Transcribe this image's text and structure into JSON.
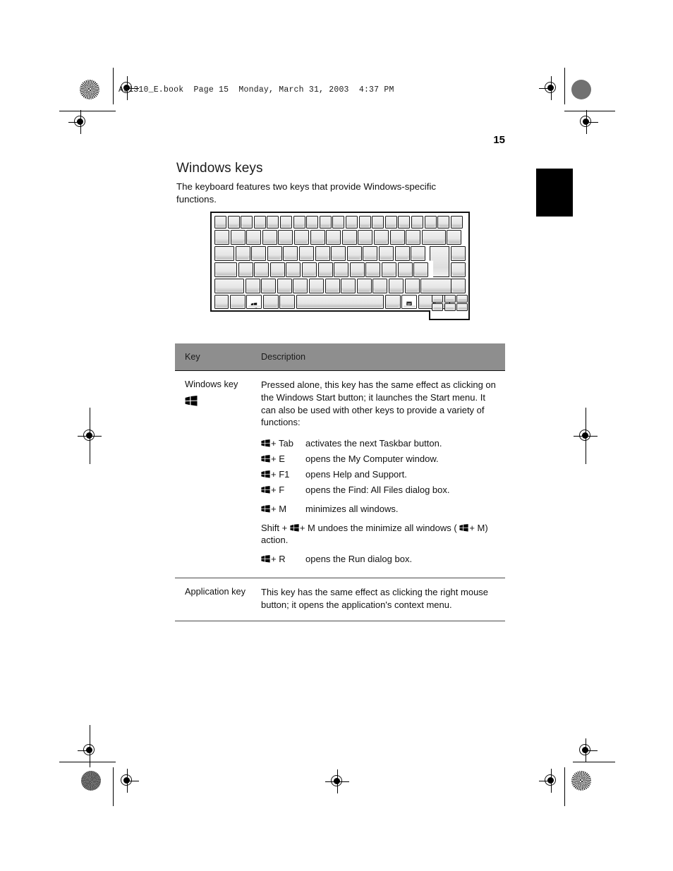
{
  "document": {
    "running_header": "As1310_E.book  Page 15  Monday, March 31, 2003  4:37 PM",
    "page_number": "15"
  },
  "section": {
    "title": "Windows keys",
    "intro": "The keyboard features two keys that provide Windows-specific functions."
  },
  "figure": {
    "name": "notebook-keyboard-diagram",
    "win_key_label": "windows-logo-key",
    "app_key_label": "application-key"
  },
  "table": {
    "header": {
      "key": "Key",
      "description": "Description"
    },
    "rows": [
      {
        "key_label": "Windows key",
        "key_icon": "windows-flag-icon",
        "description": "Pressed alone, this key has the same effect as clicking on the Windows Start button; it launches the Start menu. It can also be used with other keys to provide a variety of functions:",
        "shortcuts": [
          {
            "combo": "+ Tab",
            "desc": "activates the next Taskbar button."
          },
          {
            "combo": "+ E",
            "desc": "opens the My Computer window."
          },
          {
            "combo": "+ F1",
            "desc": "opens Help and Support."
          },
          {
            "combo": "+ F",
            "desc": "opens the Find: All Files dialog box."
          },
          {
            "combo": "+ M",
            "desc": "minimizes all windows."
          }
        ],
        "shift_line": {
          "prefix": "Shift + ",
          "mid": "+ M  undoes the minimize all windows ( ",
          "suffix": "+ M)  action."
        },
        "last_shortcut": {
          "combo": "+ R",
          "desc": "opens the Run dialog box."
        }
      },
      {
        "key_label": "Application key",
        "key_icon": "",
        "description": "This key has the same effect as clicking the right mouse button; it opens the application's context menu."
      }
    ]
  },
  "colors": {
    "table_header_bg": "#8e8e8e",
    "text": "#111111",
    "tab_marker": "#000000"
  }
}
